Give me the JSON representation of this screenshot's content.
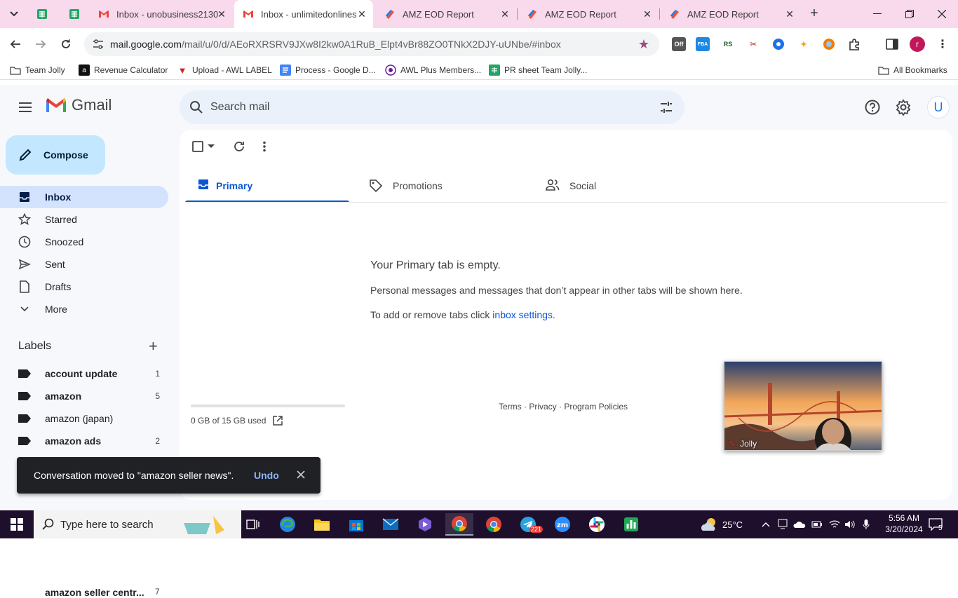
{
  "browser": {
    "tabs": [
      {
        "title": "Inbox - unobusiness2130",
        "favicon": "gmail-icon",
        "active": false
      },
      {
        "title": "Inbox - unlimitedonlines",
        "favicon": "gmail-icon",
        "active": true
      },
      {
        "title": "AMZ EOD Report",
        "favicon": "zoho-icon",
        "active": false
      },
      {
        "title": "AMZ EOD Report",
        "favicon": "zoho-icon",
        "active": false
      },
      {
        "title": "AMZ EOD Report",
        "favicon": "zoho-icon",
        "active": false
      }
    ],
    "url_host": "mail.google.com",
    "url_path": "/mail/u/0/d/AEoRXRSRV9JXw8I2kw0A1RuB_Elpt4vBr88ZO0TNkX2DJY-uUNbe/#inbox",
    "extensions": {
      "off_label": "Off",
      "fba_label": "FBA",
      "rs_label": "RS"
    },
    "profile_initial": "r",
    "bookmarks": [
      {
        "label": "Team Jolly",
        "icon": "folder-icon"
      },
      {
        "label": "Revenue Calculator",
        "icon": "amazon-icon"
      },
      {
        "label": "Upload - AWL LABEL",
        "icon": "awl-icon"
      },
      {
        "label": "Process - Google D...",
        "icon": "docs-icon"
      },
      {
        "label": "AWL Plus Members...",
        "icon": "awl-plus-icon"
      },
      {
        "label": "PR sheet Team Jolly...",
        "icon": "sheets-icon"
      }
    ],
    "all_bookmarks": "All Bookmarks"
  },
  "gmail": {
    "brand": "Gmail",
    "search_placeholder": "Search mail",
    "avatar_initial": "U",
    "compose_label": "Compose",
    "nav": [
      {
        "label": "Inbox",
        "icon": "inbox-icon",
        "active": true
      },
      {
        "label": "Starred",
        "icon": "star-icon"
      },
      {
        "label": "Snoozed",
        "icon": "clock-icon"
      },
      {
        "label": "Sent",
        "icon": "send-icon"
      },
      {
        "label": "Drafts",
        "icon": "draft-icon"
      },
      {
        "label": "More",
        "icon": "chevron-down-icon"
      }
    ],
    "labels_title": "Labels",
    "labels": [
      {
        "name": "account update",
        "count": "1"
      },
      {
        "name": "amazon",
        "count": "5"
      },
      {
        "name": "amazon (japan)",
        "count": ""
      },
      {
        "name": "amazon ads",
        "count": "2"
      }
    ],
    "peek_label": {
      "name": "amazon seller centr...",
      "count": "7"
    },
    "inbox_tabs": [
      {
        "label": "Primary",
        "active": true
      },
      {
        "label": "Promotions"
      },
      {
        "label": "Social"
      }
    ],
    "empty": {
      "title": "Your Primary tab is empty.",
      "desc": "Personal messages and messages that don’t appear in other tabs will be shown here.",
      "hint_prefix": "To add or remove tabs click ",
      "hint_link": "inbox settings",
      "hint_suffix": "."
    },
    "storage": {
      "text": "0 GB of 15 GB used",
      "fraction": 0.0
    },
    "footer": "Terms · Privacy · Program Policies",
    "snackbar": {
      "message": "Conversation moved to \"amazon seller news\".",
      "action": "Undo"
    }
  },
  "video": {
    "name": "Jolly"
  },
  "taskbar": {
    "search_placeholder": "Type here to search",
    "telegram_badge": "221",
    "weather": "25°C",
    "time": "5:56 AM",
    "date": "3/20/2024",
    "notifications": "5"
  },
  "colors": {
    "tabstrip": "#f9d9ec",
    "accent": "#0b57d0",
    "compose": "#c2e7ff",
    "active_nav": "#d3e3fd",
    "taskbar": "#1e0f2d"
  }
}
